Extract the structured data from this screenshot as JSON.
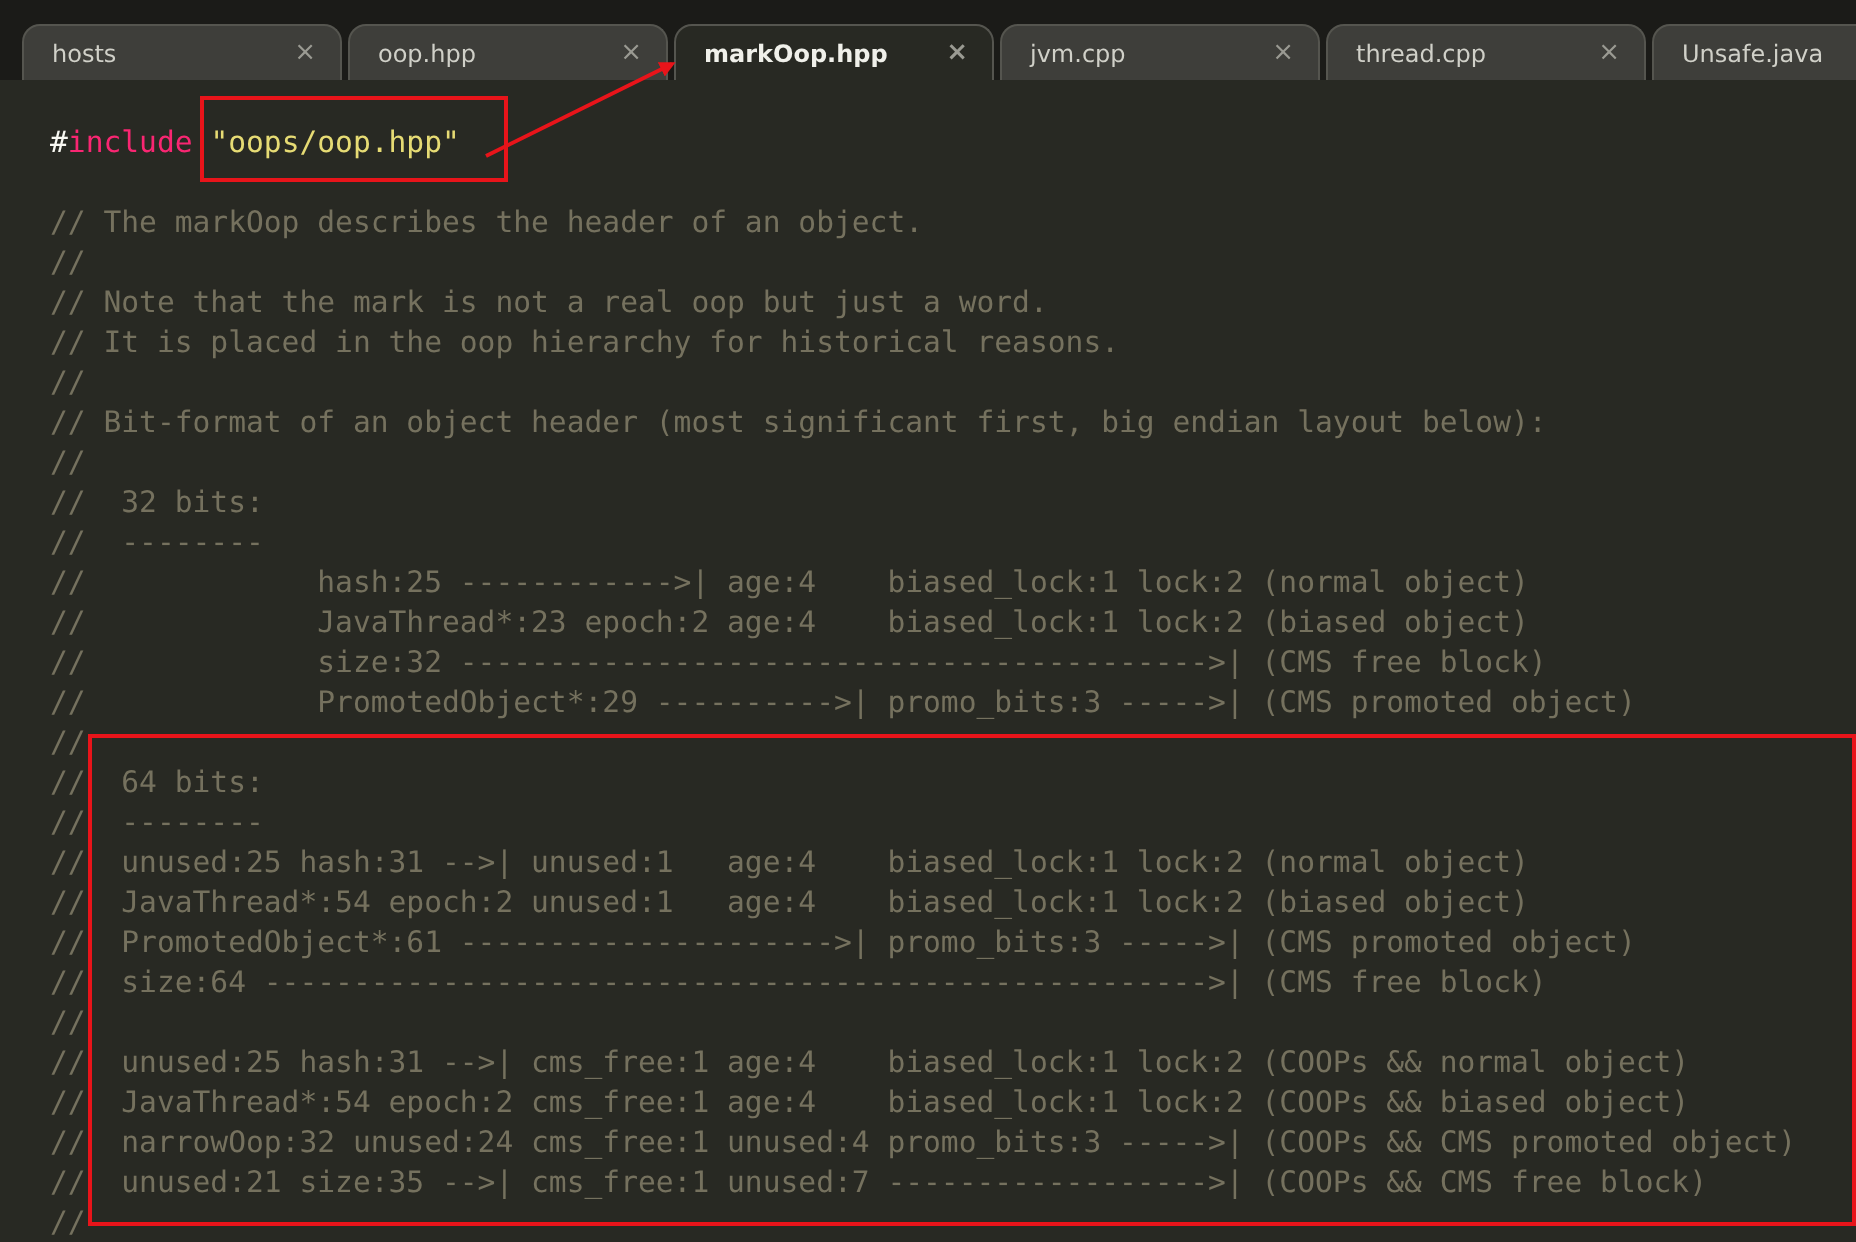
{
  "tabs": [
    {
      "label": "hosts",
      "close": "×",
      "selected": false
    },
    {
      "label": "oop.hpp",
      "close": "×",
      "selected": false
    },
    {
      "label": "markOop.hpp",
      "close": "×",
      "selected": true
    },
    {
      "label": "jvm.cpp",
      "close": "×",
      "selected": false
    },
    {
      "label": "thread.cpp",
      "close": "×",
      "selected": false
    },
    {
      "label": "Unsafe.java",
      "selected": false
    }
  ],
  "editor": {
    "lines": [
      {
        "kind": "include",
        "hash": "#",
        "keyword": "include",
        "path": "\"oops/oop.hpp\""
      },
      {
        "kind": "blank"
      },
      {
        "kind": "comment",
        "text": "// The markOop describes the header of an object."
      },
      {
        "kind": "comment",
        "text": "//"
      },
      {
        "kind": "comment",
        "text": "// Note that the mark is not a real oop but just a word."
      },
      {
        "kind": "comment",
        "text": "// It is placed in the oop hierarchy for historical reasons."
      },
      {
        "kind": "comment",
        "text": "//"
      },
      {
        "kind": "comment",
        "text": "// Bit-format of an object header (most significant first, big endian layout below):"
      },
      {
        "kind": "comment",
        "text": "//"
      },
      {
        "kind": "comment",
        "text": "//  32 bits:"
      },
      {
        "kind": "comment",
        "text": "//  --------"
      },
      {
        "kind": "comment",
        "text": "//             hash:25 ------------>| age:4    biased_lock:1 lock:2 (normal object)"
      },
      {
        "kind": "comment",
        "text": "//             JavaThread*:23 epoch:2 age:4    biased_lock:1 lock:2 (biased object)"
      },
      {
        "kind": "comment",
        "text": "//             size:32 ------------------------------------------>| (CMS free block)"
      },
      {
        "kind": "comment",
        "text": "//             PromotedObject*:29 ---------->| promo_bits:3 ----->| (CMS promoted object)"
      },
      {
        "kind": "comment",
        "text": "//"
      },
      {
        "kind": "comment",
        "text": "//  64 bits:"
      },
      {
        "kind": "comment",
        "text": "//  --------"
      },
      {
        "kind": "comment",
        "text": "//  unused:25 hash:31 -->| unused:1   age:4    biased_lock:1 lock:2 (normal object)"
      },
      {
        "kind": "comment",
        "text": "//  JavaThread*:54 epoch:2 unused:1   age:4    biased_lock:1 lock:2 (biased object)"
      },
      {
        "kind": "comment",
        "text": "//  PromotedObject*:61 --------------------->| promo_bits:3 ----->| (CMS promoted object)"
      },
      {
        "kind": "comment",
        "text": "//  size:64 ----------------------------------------------------->| (CMS free block)"
      },
      {
        "kind": "comment",
        "text": "//"
      },
      {
        "kind": "comment",
        "text": "//  unused:25 hash:31 -->| cms_free:1 age:4    biased_lock:1 lock:2 (COOPs && normal object)"
      },
      {
        "kind": "comment",
        "text": "//  JavaThread*:54 epoch:2 cms_free:1 age:4    biased_lock:1 lock:2 (COOPs && biased object)"
      },
      {
        "kind": "comment",
        "text": "//  narrowOop:32 unused:24 cms_free:1 unused:4 promo_bits:3 ----->| (COOPs && CMS promoted object)"
      },
      {
        "kind": "comment",
        "text": "//  unused:21 size:35 -->| cms_free:1 unused:7 ------------------>| (COOPs && CMS free block)"
      },
      {
        "kind": "comment",
        "text": "//"
      }
    ]
  }
}
